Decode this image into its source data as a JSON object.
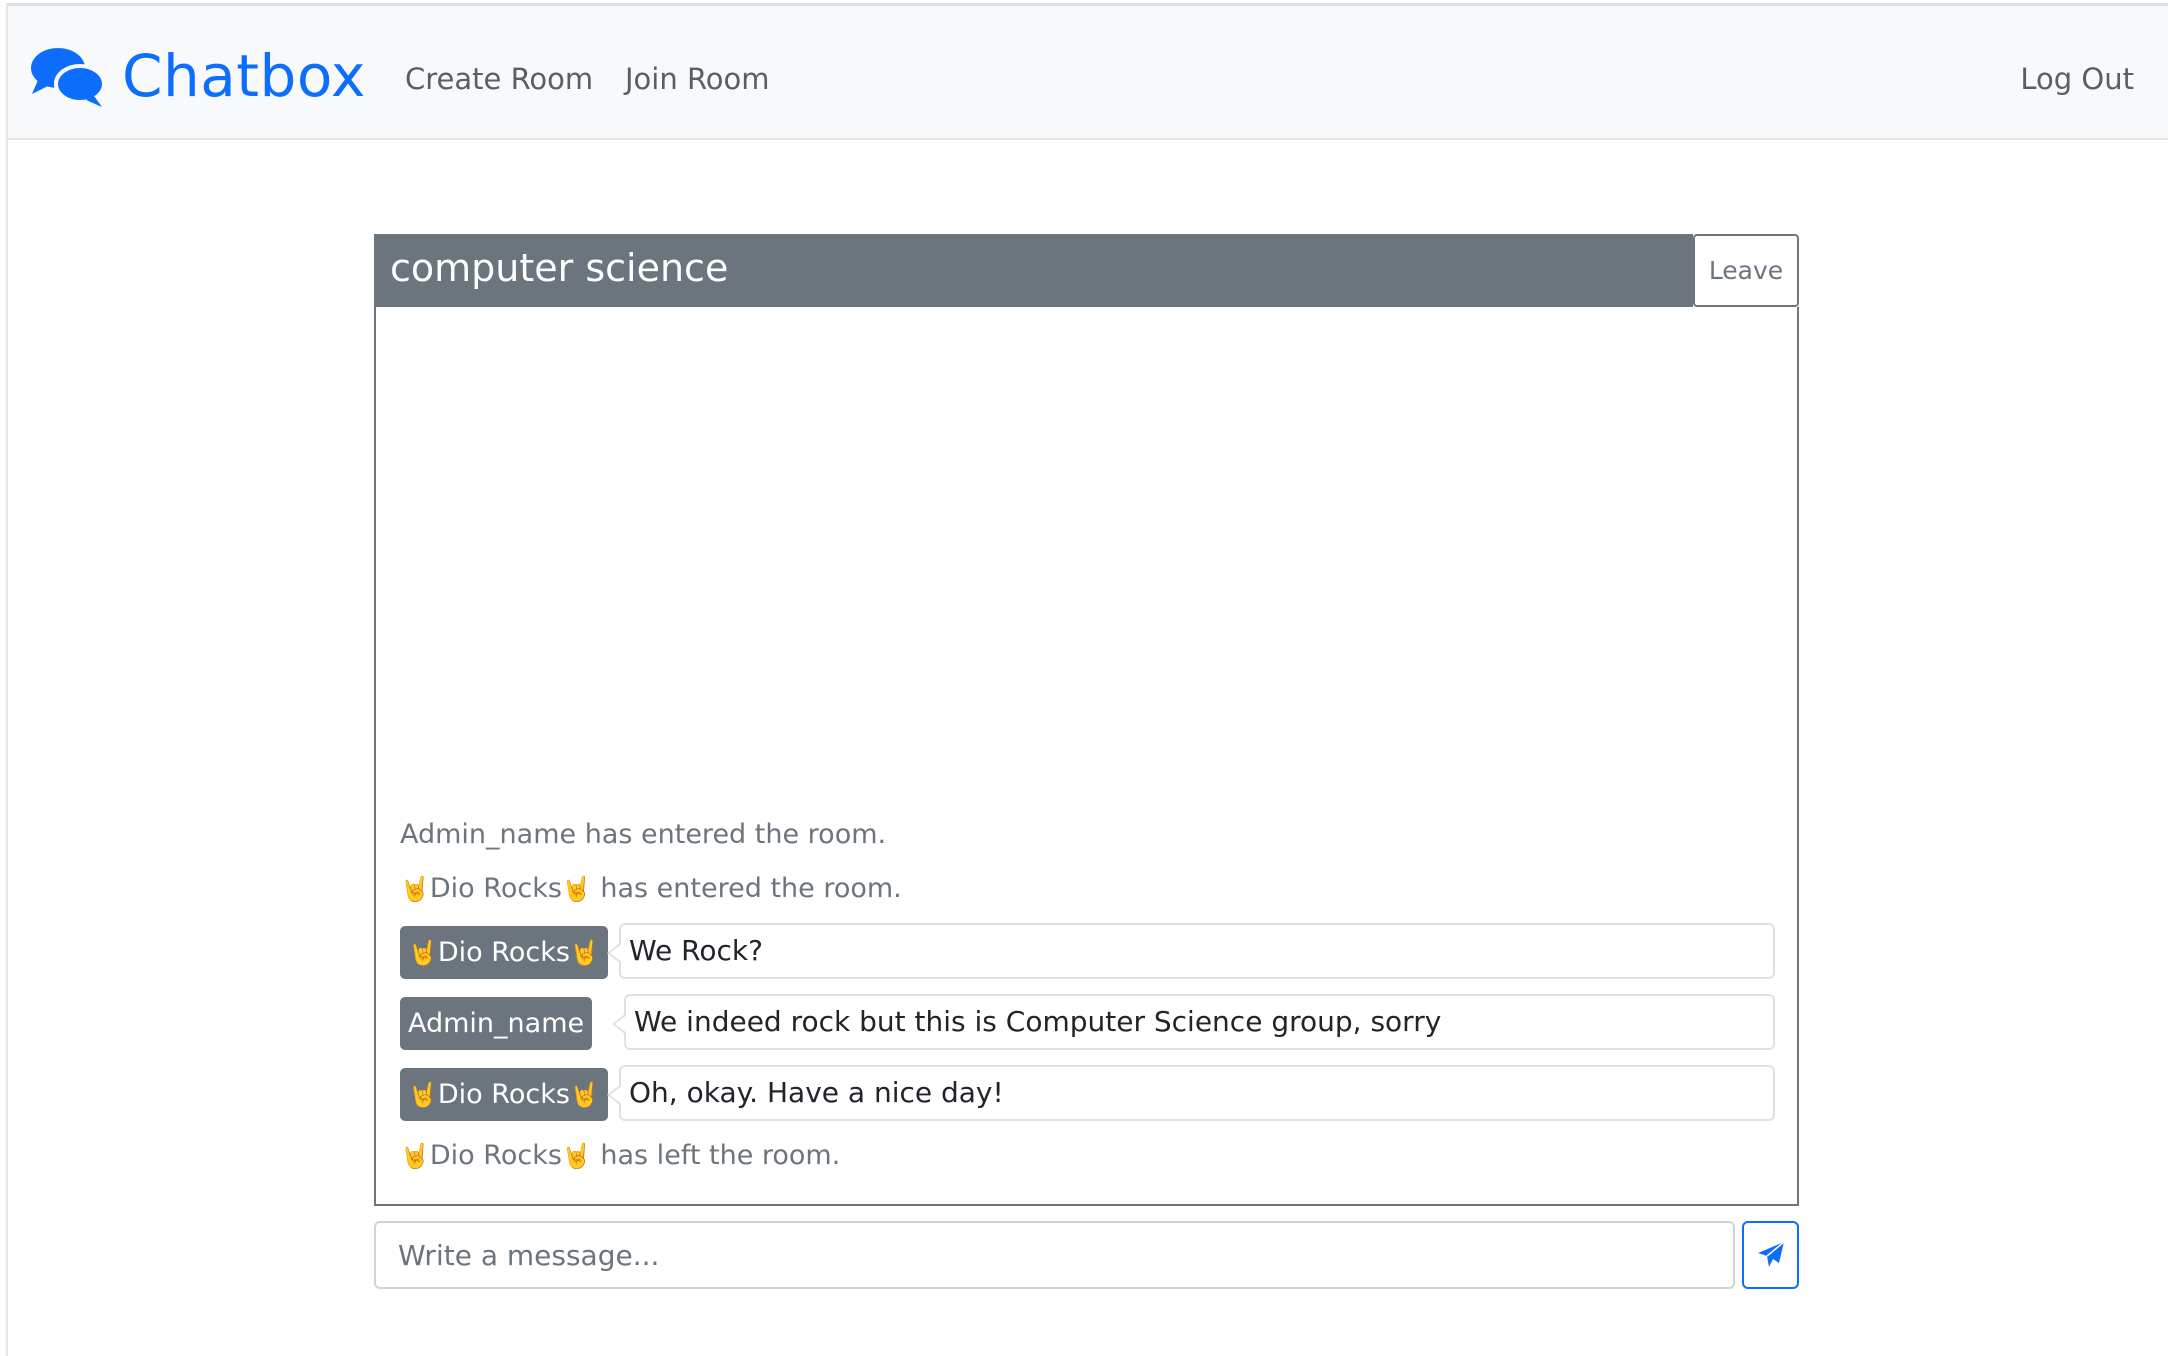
{
  "navbar": {
    "brand": "Chatbox",
    "brand_icon": "chat-bubbles-icon",
    "links": {
      "create_room": "Create Room",
      "join_room": "Join Room",
      "log_out": "Log Out"
    }
  },
  "room": {
    "title": "computer science",
    "leave_label": "Leave"
  },
  "messages": {
    "status_1": {
      "text": "Admin_name has entered the room."
    },
    "status_2": {
      "name": "Dio Rocks",
      "text": " has entered the room."
    },
    "chat_1": {
      "sender": "Dio Rocks",
      "text": "We Rock?"
    },
    "chat_2": {
      "sender": "Admin_name",
      "text": "We indeed rock but this is Computer Science group, sorry"
    },
    "chat_3": {
      "sender": "Dio Rocks",
      "text": "Oh, okay. Have a nice day!"
    },
    "status_3": {
      "name": "Dio Rocks",
      "text": " has left the room."
    }
  },
  "composer": {
    "placeholder": "Write a message...",
    "send_icon": "paper-plane-icon"
  },
  "colors": {
    "brand": "#0d6efd",
    "secondary": "#6c757d",
    "navbar_bg": "#f8f9fa",
    "rock_emoji": "#f2c230"
  }
}
